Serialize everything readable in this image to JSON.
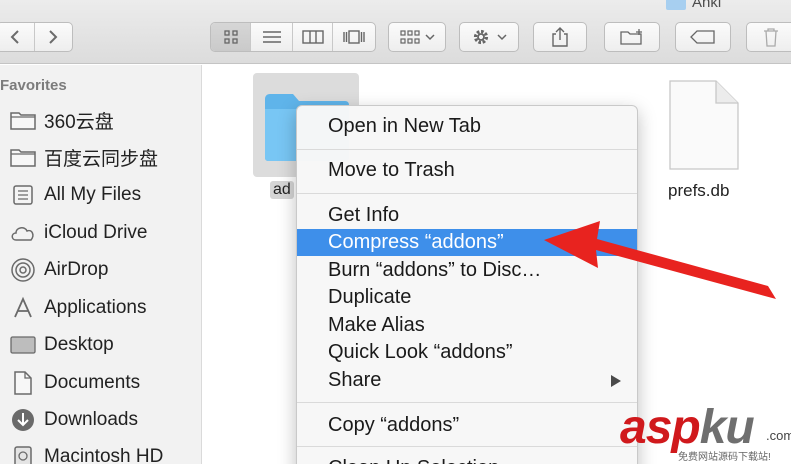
{
  "window": {
    "title": "Anki"
  },
  "toolbar": {
    "icons": [
      "chevron-left-icon",
      "chevron-right-icon",
      "icon-view-icon",
      "list-view-icon",
      "column-view-icon",
      "coverflow-view-icon",
      "arrange-icon",
      "gear-icon",
      "share-icon",
      "new-folder-icon",
      "tag-icon",
      "trash-icon"
    ]
  },
  "sidebar": {
    "heading": "Favorites",
    "items": [
      {
        "label": "360云盘",
        "icon": "folder-icon"
      },
      {
        "label": "百度云同步盘",
        "icon": "folder-icon"
      },
      {
        "label": "All My Files",
        "icon": "all-files-icon"
      },
      {
        "label": "iCloud Drive",
        "icon": "cloud-icon"
      },
      {
        "label": "AirDrop",
        "icon": "airdrop-icon"
      },
      {
        "label": "Applications",
        "icon": "applications-icon"
      },
      {
        "label": "Desktop",
        "icon": "desktop-icon"
      },
      {
        "label": "Documents",
        "icon": "documents-icon"
      },
      {
        "label": "Downloads",
        "icon": "downloads-icon"
      },
      {
        "label": "Macintosh HD",
        "icon": "disk-icon"
      }
    ]
  },
  "files": [
    {
      "name": "ad",
      "icon": "folder-icon",
      "selected": true
    },
    {
      "name": "prefs.db",
      "icon": "document-icon",
      "selected": false
    }
  ],
  "context_menu": {
    "items": [
      {
        "label": "Open in New Tab"
      },
      {
        "label": "Move to Trash"
      },
      {
        "label": "Get Info"
      },
      {
        "label": "Compress “addons”",
        "highlighted": true
      },
      {
        "label": "Burn “addons” to Disc…"
      },
      {
        "label": "Duplicate"
      },
      {
        "label": "Make Alias"
      },
      {
        "label": "Quick Look “addons”"
      },
      {
        "label": "Share",
        "has_submenu": true
      },
      {
        "label": "Copy “addons”"
      },
      {
        "label": "Clean Up Selection"
      }
    ],
    "highlight_color": "#3e8fea"
  },
  "annotation": {
    "color": "#e8231f"
  },
  "watermark": {
    "text_main": "asp",
    "text_accent": "ku",
    "text_suffix": ".com",
    "text_sub": "免费网站源码下载站!"
  }
}
